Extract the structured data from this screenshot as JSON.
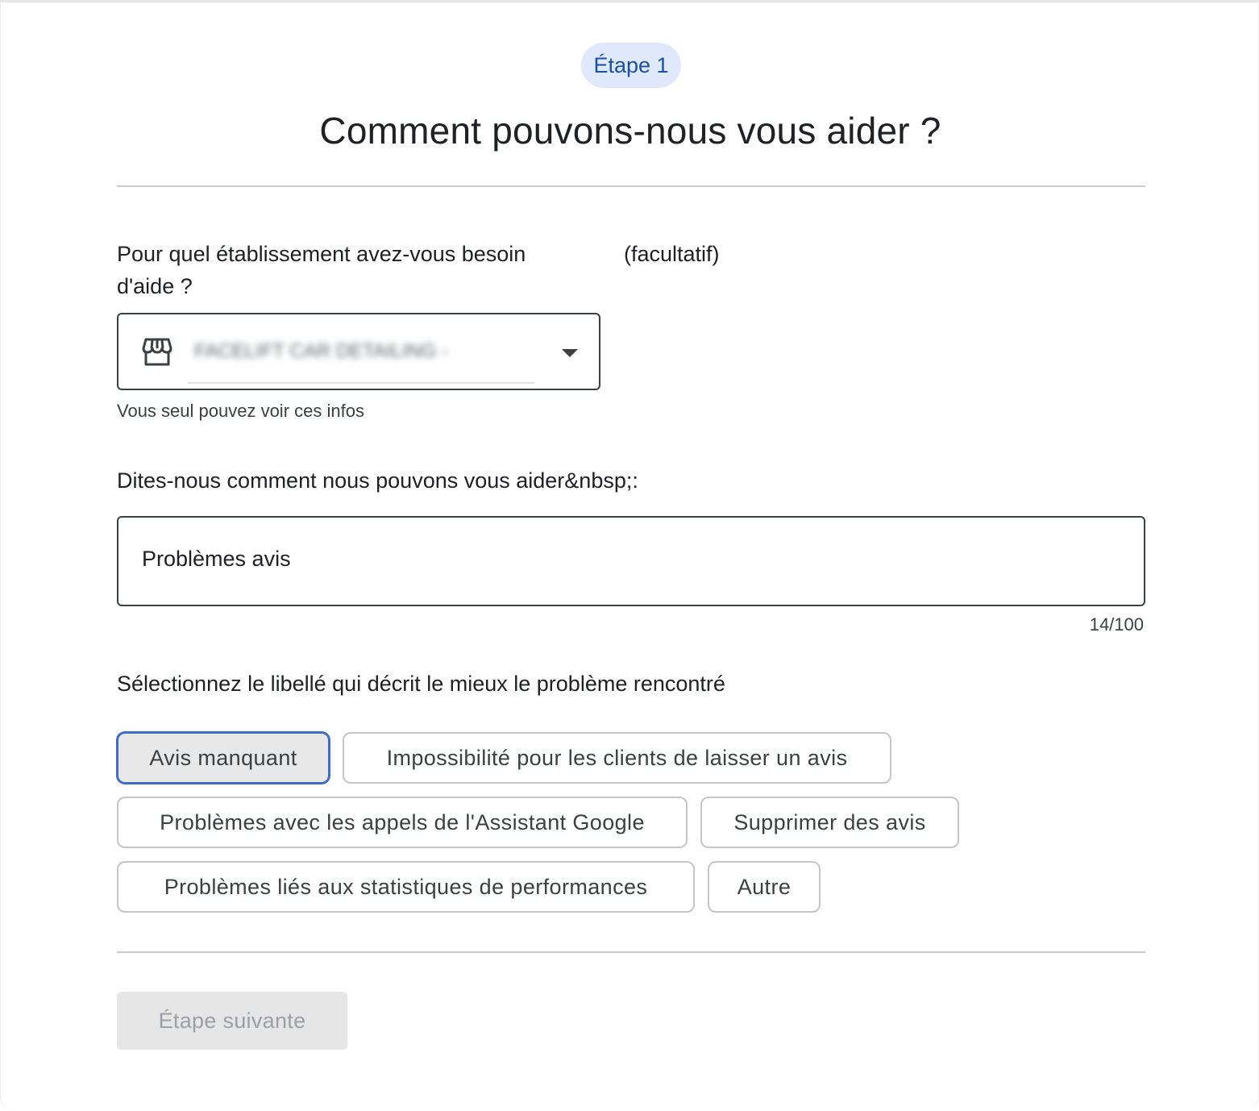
{
  "step": {
    "label": "Étape 1"
  },
  "title": "Comment pouvons-nous vous aider ?",
  "business": {
    "question": "Pour quel établissement avez-vous besoin d'aide ?",
    "optional": "(facultatif)",
    "selected_value": "FACELIFT CAR DETAILING - C...",
    "helper": "Vous seul pouvez voir ces infos",
    "icon": "store-icon"
  },
  "describe": {
    "label": "Dites-nous comment nous pouvons vous aider&nbsp;:",
    "value": "Problèmes avis",
    "counter": "14/100"
  },
  "labels": {
    "prompt": "Sélectionnez le libellé qui décrit le mieux le problème rencontré",
    "chips": [
      {
        "label": "Avis manquant",
        "selected": true
      },
      {
        "label": "Impossibilité pour les clients de laisser un avis",
        "selected": false
      },
      {
        "label": "Problèmes avec les appels de l'Assistant Google",
        "selected": false
      },
      {
        "label": "Supprimer des avis",
        "selected": false
      },
      {
        "label": "Problèmes liés aux statistiques de performances",
        "selected": false
      },
      {
        "label": "Autre",
        "selected": false
      }
    ]
  },
  "next_button": {
    "label": "Étape suivante",
    "enabled": false
  },
  "colors": {
    "accent": "#3f6cc9",
    "step_pill_bg": "#dfe9fb",
    "step_pill_text": "#1a4fa8",
    "disabled_bg": "#e6e6e6",
    "disabled_text": "#9aa0a6"
  }
}
